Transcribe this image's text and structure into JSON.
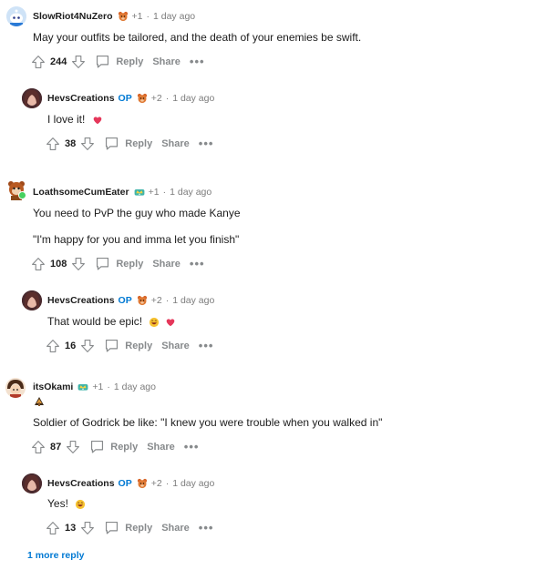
{
  "comments": [
    {
      "author": "SlowRiot4NuZero",
      "karma": "+1",
      "time": "1 day ago",
      "lines": [
        "May your outfits be tailored, and the death of your enemies be swift."
      ],
      "score": "244",
      "reply": "Reply",
      "share": "Share",
      "more": "•••"
    },
    {
      "author": "HevsCreations",
      "op": "OP",
      "karma": "+2",
      "time": "1 day ago",
      "lines": [
        "I love it!"
      ],
      "score": "38",
      "reply": "Reply",
      "share": "Share",
      "more": "•••"
    },
    {
      "author": "LoathsomeCumEater",
      "karma": "+1",
      "time": "1 day ago",
      "lines": [
        "You need to PvP the guy who made Kanye",
        "\"I'm happy for you and imma let you finish\""
      ],
      "score": "108",
      "reply": "Reply",
      "share": "Share",
      "more": "•••"
    },
    {
      "author": "HevsCreations",
      "op": "OP",
      "karma": "+2",
      "time": "1 day ago",
      "lines": [
        "That would be epic!"
      ],
      "score": "16",
      "reply": "Reply",
      "share": "Share",
      "more": "•••"
    },
    {
      "author": "itsOkami",
      "karma": "+1",
      "time": "1 day ago",
      "lines": [
        "Soldier of Godrick be like: \"I knew you were trouble when you walked in\""
      ],
      "score": "87",
      "reply": "Reply",
      "share": "Share",
      "more": "•••"
    },
    {
      "author": "HevsCreations",
      "op": "OP",
      "karma": "+2",
      "time": "1 day ago",
      "lines": [
        "Yes!"
      ],
      "score": "13",
      "reply": "Reply",
      "share": "Share",
      "more": "•••"
    }
  ],
  "more_replies": "1 more reply",
  "colors": {
    "op": "#0079d3",
    "meta": "#7c7c7c",
    "action": "#878a8c",
    "heart": "#e5375a"
  },
  "icons": [
    "upvote-icon",
    "downvote-icon",
    "reply-bubble-icon",
    "heart-icon",
    "grin-emoji-icon"
  ]
}
